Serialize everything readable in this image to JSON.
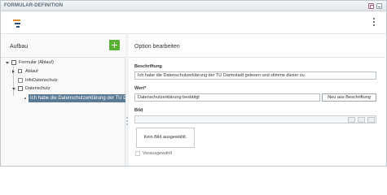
{
  "window": {
    "title": "FORMULAR-DEFINITION"
  },
  "toolbar": {
    "logo_icon": "app-logo-icon",
    "more_icon": "more-vertical-icon"
  },
  "left": {
    "header": "Aufbau",
    "add_icon": "plus-icon",
    "tree": [
      {
        "label": "Formular (Ablauf)",
        "icon": "checkbox-form-icon",
        "expanded": true
      },
      {
        "label": "Ablauf",
        "icon": "flow-icon",
        "expanded": false
      },
      {
        "label": "InfoDatenschutz",
        "icon": "document-icon"
      },
      {
        "label": "Datenschutz",
        "icon": "checkbox-icon",
        "expanded": true
      },
      {
        "label": "Ich habe die Datenschutzerklärung der TU D",
        "icon": "bullet-icon",
        "selected": true
      }
    ]
  },
  "right": {
    "header": "Option bearbeiten",
    "beschriftung_label": "Beschriftung",
    "beschriftung_value": "Ich habe die Datenschutzerklärung der TU Darmstadt gelesen und stimme dieser zu.",
    "wert_label": "Wert*",
    "wert_value": "Datenschutzerklärung bestätigt",
    "neu_button": "Neu aus Beschriftung",
    "bild_label": "Bild",
    "no_image": "Kein Bild ausgewählt.",
    "vorausgewaehlt": "Vorausgewählt",
    "vorausgewaehlt_checked": false
  },
  "colors": {
    "accent": "#5ab035",
    "selection": "#5d7a93",
    "title": "#5a6b78"
  }
}
